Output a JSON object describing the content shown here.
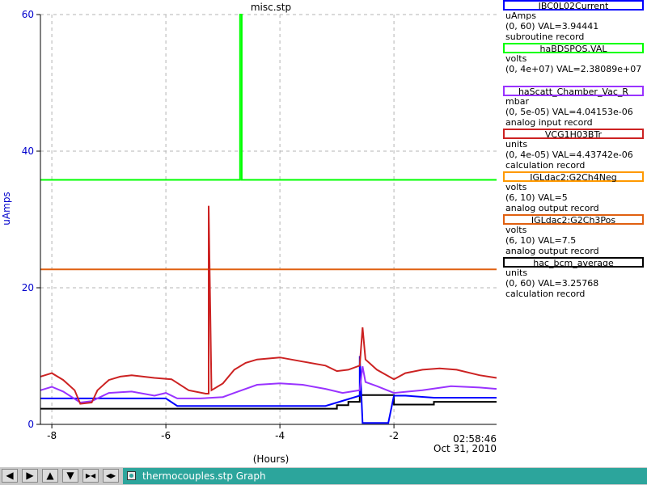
{
  "plot": {
    "title": "misc.stp",
    "ylabel": "uAmps",
    "xlabel": "(Hours)",
    "y_ticks": [
      "0",
      "20",
      "40",
      "60"
    ],
    "x_ticks": [
      "-8",
      "-6",
      "-4",
      "-2"
    ],
    "time_label": "02:58:46",
    "date_label": "Oct 31, 2010"
  },
  "colors": {
    "grid": "#b4b4b4",
    "axis": "#000000",
    "ylabel": "#0000cc"
  },
  "legend": [
    {
      "name": "IBC0L02Current",
      "color": "#0000ff",
      "unit": "uAmps",
      "range": "(0, 60) VAL=3.94441",
      "type": "subroutine record"
    },
    {
      "name": "haBDSPOS.VAL",
      "color": "#00ff00",
      "unit": "volts",
      "range": "(0, 4e+07) VAL=2.38089e+07",
      "type": "",
      "name_align": "center"
    },
    {
      "name": "haScatt_Chamber_Vac_R",
      "color": "#9933ff",
      "unit": "mbar",
      "range": "(0, 5e-05) VAL=4.04153e-06",
      "type": "analog input record"
    },
    {
      "name": "VCG1H03BTr",
      "color": "#cc2222",
      "unit": "units",
      "range": "(0, 4e-05) VAL=4.43742e-06",
      "type": "calculation record"
    },
    {
      "name": "IGLdac2:G2Ch4Neg",
      "color": "#ff9900",
      "unit": "volts",
      "range": "(6, 10) VAL=5",
      "type": "analog output record"
    },
    {
      "name": "IGLdac2:G2Ch3Pos",
      "color": "#e06010",
      "unit": "volts",
      "range": "(6, 10) VAL=7.5",
      "type": "analog output record"
    },
    {
      "name": "hac_bcm_average",
      "color": "#000000",
      "unit": "units",
      "range": "(0, 60) VAL=3.25768",
      "type": "calculation record"
    }
  ],
  "chart_data": {
    "type": "line",
    "title": "misc.stp",
    "xlabel": "(Hours)",
    "ylabel": "uAmps",
    "xlim": [
      -8.2,
      -0.2
    ],
    "ylim": [
      0,
      60
    ],
    "grid": true,
    "legend_placement": "right",
    "series": [
      {
        "name": "haBDSPOS.VAL",
        "color": "#00ff00",
        "x": [
          -8.2,
          -4.7,
          -4.7,
          -4.67,
          -4.67,
          -0.2
        ],
        "y": [
          35.8,
          35.8,
          60,
          60,
          35.8,
          35.8
        ]
      },
      {
        "name": "IGLdac2:G2Ch3Pos",
        "color": "#e06010",
        "x": [
          -8.2,
          -0.2
        ],
        "y": [
          22.7,
          22.7
        ]
      },
      {
        "name": "hac_bcm_average",
        "color": "#000000",
        "x": [
          -8.2,
          -7.3,
          -7.3,
          -3.0,
          -3.0,
          -2.8,
          -2.8,
          -2.6,
          -2.6,
          -2.0,
          -2.0,
          -1.3,
          -1.3,
          -0.2
        ],
        "y": [
          2.3,
          2.3,
          2.3,
          2.3,
          2.8,
          2.8,
          3.3,
          3.3,
          4.3,
          4.3,
          2.9,
          2.9,
          3.3,
          3.3
        ]
      },
      {
        "name": "IBC0L02Current",
        "color": "#0000ff",
        "x": [
          -8.2,
          -7.5,
          -7.3,
          -6.0,
          -5.8,
          -5.6,
          -3.2,
          -3.0,
          -2.6,
          -2.6,
          -2.55,
          -2.5,
          -2.4,
          -2.1,
          -2.0,
          -1.8,
          -1.3,
          -0.2
        ],
        "y": [
          3.8,
          3.8,
          3.8,
          3.8,
          2.7,
          2.7,
          2.7,
          3.2,
          4.2,
          10.0,
          0.2,
          0.2,
          0.2,
          0.2,
          4.2,
          4.2,
          3.9,
          3.9
        ]
      },
      {
        "name": "haScatt_Chamber_Vac_R",
        "color": "#9933ff",
        "x": [
          -8.2,
          -8.0,
          -7.8,
          -7.5,
          -7.3,
          -7.0,
          -6.6,
          -6.2,
          -6.0,
          -5.8,
          -5.4,
          -5.0,
          -4.8,
          -4.4,
          -4.0,
          -3.6,
          -3.2,
          -2.9,
          -2.6,
          -2.55,
          -2.5,
          -2.3,
          -2.0,
          -1.5,
          -1.0,
          -0.5,
          -0.2
        ],
        "y": [
          5.0,
          5.5,
          4.8,
          3.2,
          3.4,
          4.6,
          4.8,
          4.2,
          4.6,
          3.8,
          3.8,
          4.0,
          4.6,
          5.8,
          6.0,
          5.8,
          5.2,
          4.6,
          5.0,
          8.5,
          6.2,
          5.6,
          4.6,
          5.0,
          5.6,
          5.4,
          5.2
        ]
      },
      {
        "name": "VCG1H03BTr",
        "color": "#cc2222",
        "x": [
          -8.2,
          -8.0,
          -7.8,
          -7.6,
          -7.5,
          -7.3,
          -7.2,
          -7.0,
          -6.8,
          -6.6,
          -6.2,
          -5.9,
          -5.6,
          -5.3,
          -5.25,
          -5.25,
          -5.2,
          -5.0,
          -4.8,
          -4.6,
          -4.4,
          -4.0,
          -3.6,
          -3.2,
          -3.0,
          -2.8,
          -2.6,
          -2.55,
          -2.5,
          -2.3,
          -2.0,
          -1.8,
          -1.5,
          -1.2,
          -0.9,
          -0.5,
          -0.2
        ],
        "y": [
          7.0,
          7.5,
          6.5,
          5.0,
          3.0,
          3.2,
          5.0,
          6.5,
          7.0,
          7.2,
          6.8,
          6.6,
          5.0,
          4.5,
          4.5,
          32.0,
          5.0,
          6.0,
          8.0,
          9.0,
          9.5,
          9.8,
          9.2,
          8.6,
          7.8,
          8.0,
          8.6,
          14.2,
          9.5,
          8.0,
          6.6,
          7.5,
          8.0,
          8.2,
          8.0,
          7.2,
          6.8
        ]
      }
    ]
  },
  "nav": {
    "left": "◀",
    "right": "▶",
    "up": "▲",
    "down": "▼",
    "zoom_in": "▶◀",
    "zoom_out": "◀▶"
  },
  "taskbar": {
    "label": "thermocouples.stp Graph"
  }
}
